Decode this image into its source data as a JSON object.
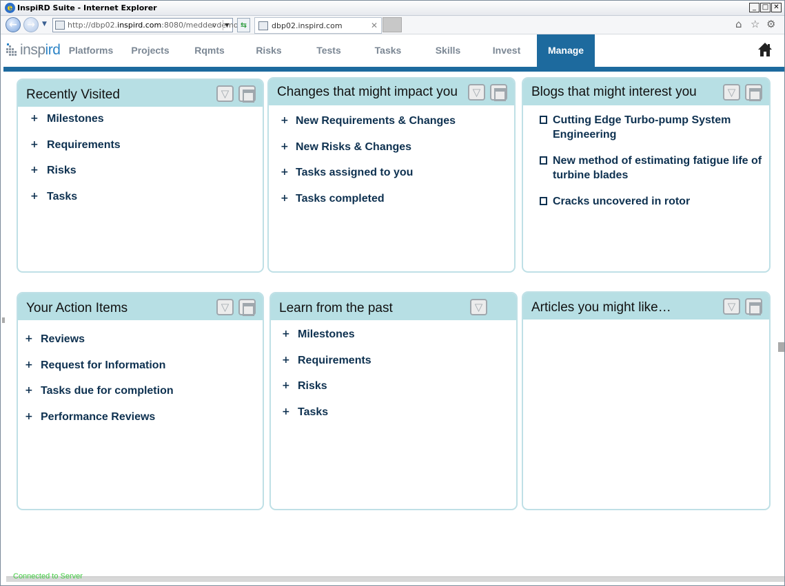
{
  "browser": {
    "title": "InspiRD Suite - Internet Explorer",
    "address_prefix": "http://dbp02.",
    "address_domain": "inspird.com",
    "address_suffix": ":8080/meddevdemo/",
    "tab_title": "dbp02.inspird.com",
    "window_buttons": {
      "minimize": "_",
      "restore": "□",
      "close": "✕"
    }
  },
  "app": {
    "logo_prefix": "insp",
    "logo_accent": "ird",
    "nav": [
      {
        "label": "Platforms",
        "active": false
      },
      {
        "label": "Projects",
        "active": false
      },
      {
        "label": "Rqmts",
        "active": false
      },
      {
        "label": "Risks",
        "active": false
      },
      {
        "label": "Tests",
        "active": false
      },
      {
        "label": "Tasks",
        "active": false
      },
      {
        "label": "Skills",
        "active": false
      },
      {
        "label": "Invest",
        "active": false
      },
      {
        "label": "Manage",
        "active": true
      }
    ],
    "accent_color": "#1d6a9e",
    "header_color": "#b7dfe4"
  },
  "widgets": {
    "recently_visited": {
      "title": "Recently Visited",
      "items": [
        "Milestones",
        "Requirements",
        "Risks",
        "Tasks"
      ]
    },
    "changes": {
      "title": "Changes that might impact you",
      "items": [
        "New Requirements & Changes",
        "New Risks & Changes",
        "Tasks assigned to you",
        "Tasks completed"
      ]
    },
    "blogs": {
      "title": "Blogs that might interest you",
      "items": [
        "Cutting Edge Turbo-pump System Engineering",
        "New method of estimating fatigue life of turbine blades",
        "Cracks uncovered in rotor"
      ]
    },
    "action_items": {
      "title": "Your Action Items",
      "items": [
        "Reviews",
        "Request for Information",
        "Tasks due for completion",
        "Performance Reviews"
      ]
    },
    "learn": {
      "title": "Learn from the past",
      "items": [
        "Milestones",
        "Requirements",
        "Risks",
        "Tasks"
      ]
    },
    "articles": {
      "title": "Articles you might like…",
      "items": []
    }
  },
  "list_marker": "+",
  "status": {
    "connection": "Connected to Server"
  }
}
